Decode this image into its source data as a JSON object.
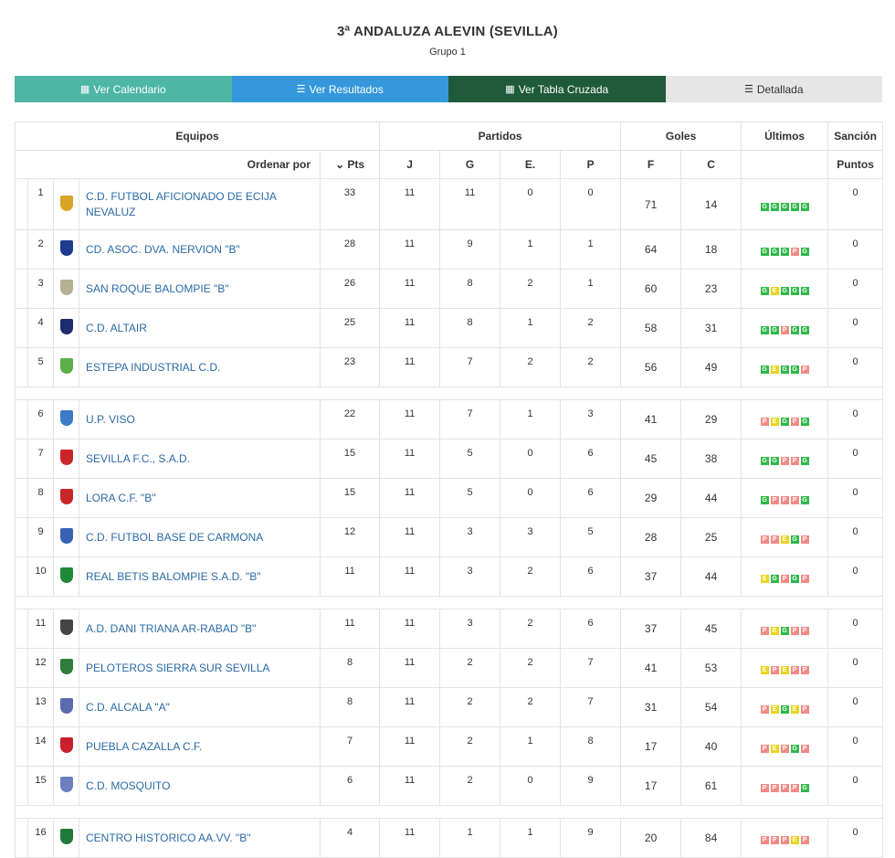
{
  "title": "3ª ANDALUZA ALEVIN (SEVILLA)",
  "subtitle": "Grupo 1",
  "tabs": [
    {
      "label": "Ver Calendario",
      "icon": "calendar-icon"
    },
    {
      "label": "Ver Resultados",
      "icon": "list-icon"
    },
    {
      "label": "Ver Tabla Cruzada",
      "icon": "calculator-icon"
    },
    {
      "label": "Detallada",
      "icon": "detail-list-icon"
    }
  ],
  "colors": {
    "tab1": "#4db6a4",
    "tab2": "#3498db",
    "tab3": "#1f5a3a",
    "tab4": "#e6e6e6",
    "win": "#2fb84a",
    "draw": "#e8d51e",
    "loss": "#f08a86",
    "link": "#2a6aa6"
  },
  "headers": {
    "equipos": "Equipos",
    "partidos": "Partidos",
    "goles": "Goles",
    "ultimos": "Últimos",
    "sancion": "Sanción",
    "ordenar": "Ordenar por",
    "pts": "Pts",
    "j": "J",
    "g": "G",
    "e": "E.",
    "p": "P",
    "f": "F",
    "c": "C",
    "puntos": "Puntos"
  },
  "teams": [
    {
      "pos": "1",
      "name": "C.D. FUTBOL AFICIONADO DE ECIJA NEVALUZ",
      "pts": "33",
      "j": "11",
      "g": "11",
      "e": "0",
      "p": "0",
      "f": "71",
      "c": "14",
      "last": [
        "G",
        "G",
        "G",
        "G",
        "G"
      ],
      "pun": "0"
    },
    {
      "pos": "2",
      "name": "CD. ASOC. DVA. NERVION \"B\"",
      "pts": "28",
      "j": "11",
      "g": "9",
      "e": "1",
      "p": "1",
      "f": "64",
      "c": "18",
      "last": [
        "G",
        "G",
        "G",
        "P",
        "G"
      ],
      "pun": "0"
    },
    {
      "pos": "3",
      "name": "SAN ROQUE BALOMPIE \"B\"",
      "pts": "26",
      "j": "11",
      "g": "8",
      "e": "2",
      "p": "1",
      "f": "60",
      "c": "23",
      "last": [
        "G",
        "E",
        "G",
        "G",
        "G"
      ],
      "pun": "0"
    },
    {
      "pos": "4",
      "name": "C.D. ALTAIR",
      "pts": "25",
      "j": "11",
      "g": "8",
      "e": "1",
      "p": "2",
      "f": "58",
      "c": "31",
      "last": [
        "G",
        "G",
        "P",
        "G",
        "G"
      ],
      "pun": "0"
    },
    {
      "pos": "5",
      "name": "ESTEPA INDUSTRIAL C.D.",
      "pts": "23",
      "j": "11",
      "g": "7",
      "e": "2",
      "p": "2",
      "f": "56",
      "c": "49",
      "last": [
        "G",
        "E",
        "G",
        "G",
        "P"
      ],
      "pun": "0"
    },
    {
      "pos": "6",
      "name": "U.P. VISO",
      "pts": "22",
      "j": "11",
      "g": "7",
      "e": "1",
      "p": "3",
      "f": "41",
      "c": "29",
      "last": [
        "P",
        "E",
        "G",
        "P",
        "G"
      ],
      "pun": "0"
    },
    {
      "pos": "7",
      "name": "SEVILLA F.C., S.A.D.",
      "pts": "15",
      "j": "11",
      "g": "5",
      "e": "0",
      "p": "6",
      "f": "45",
      "c": "38",
      "last": [
        "G",
        "G",
        "P",
        "P",
        "G"
      ],
      "pun": "0"
    },
    {
      "pos": "8",
      "name": "LORA C.F. \"B\"",
      "pts": "15",
      "j": "11",
      "g": "5",
      "e": "0",
      "p": "6",
      "f": "29",
      "c": "44",
      "last": [
        "G",
        "P",
        "P",
        "P",
        "G"
      ],
      "pun": "0"
    },
    {
      "pos": "9",
      "name": "C.D. FUTBOL BASE DE CARMONA",
      "pts": "12",
      "j": "11",
      "g": "3",
      "e": "3",
      "p": "5",
      "f": "28",
      "c": "25",
      "last": [
        "P",
        "P",
        "E",
        "G",
        "P"
      ],
      "pun": "0"
    },
    {
      "pos": "10",
      "name": "REAL BETIS BALOMPIE S.A.D. \"B\"",
      "pts": "11",
      "j": "11",
      "g": "3",
      "e": "2",
      "p": "6",
      "f": "37",
      "c": "44",
      "last": [
        "E",
        "G",
        "P",
        "G",
        "P"
      ],
      "pun": "0"
    },
    {
      "pos": "11",
      "name": "A.D. DANI TRIANA AR-RABAD \"B\"",
      "pts": "11",
      "j": "11",
      "g": "3",
      "e": "2",
      "p": "6",
      "f": "37",
      "c": "45",
      "last": [
        "P",
        "E",
        "G",
        "P",
        "P"
      ],
      "pun": "0"
    },
    {
      "pos": "12",
      "name": "PELOTEROS SIERRA SUR SEVILLA",
      "pts": "8",
      "j": "11",
      "g": "2",
      "e": "2",
      "p": "7",
      "f": "41",
      "c": "53",
      "last": [
        "E",
        "P",
        "E",
        "P",
        "P"
      ],
      "pun": "0"
    },
    {
      "pos": "13",
      "name": "C.D. ALCALA \"A\"",
      "pts": "8",
      "j": "11",
      "g": "2",
      "e": "2",
      "p": "7",
      "f": "31",
      "c": "54",
      "last": [
        "P",
        "E",
        "G",
        "E",
        "P"
      ],
      "pun": "0"
    },
    {
      "pos": "14",
      "name": "PUEBLA CAZALLA C.F.",
      "pts": "7",
      "j": "11",
      "g": "2",
      "e": "1",
      "p": "8",
      "f": "17",
      "c": "40",
      "last": [
        "P",
        "E",
        "P",
        "G",
        "P"
      ],
      "pun": "0"
    },
    {
      "pos": "15",
      "name": "C.D. MOSQUITO",
      "pts": "6",
      "j": "11",
      "g": "2",
      "e": "0",
      "p": "9",
      "f": "17",
      "c": "61",
      "last": [
        "P",
        "P",
        "P",
        "P",
        "G"
      ],
      "pun": "0"
    },
    {
      "pos": "16",
      "name": "CENTRO HISTORICO AA.VV. \"B\"",
      "pts": "4",
      "j": "11",
      "g": "1",
      "e": "1",
      "p": "9",
      "f": "20",
      "c": "84",
      "last": [
        "P",
        "P",
        "P",
        "E",
        "P"
      ],
      "pun": "0"
    }
  ]
}
